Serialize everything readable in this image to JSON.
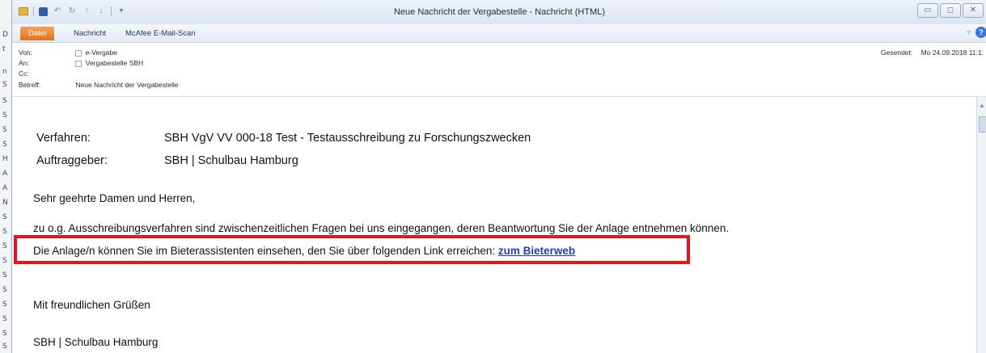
{
  "window": {
    "title": "Neue Nachricht der Vergabestelle  -  Nachricht (HTML)",
    "controls": {
      "minimize": "▭",
      "maximize": "◻",
      "close": "✕"
    }
  },
  "left_strip": {
    "letters": [
      "D",
      "t",
      "n",
      "S",
      "S",
      "S",
      "S",
      "S",
      "H",
      "A",
      "A",
      "N",
      "S",
      "S",
      "S",
      "S",
      "S",
      "S",
      "S",
      "S",
      "S",
      "S"
    ]
  },
  "ribbon": {
    "tabs": [
      "Datei",
      "Nachricht",
      "McAfee E-Mail-Scan"
    ]
  },
  "header": {
    "from_label": "Von:",
    "from_value": "e-Vergabe",
    "to_label": "An:",
    "to_value": "Vergabestelle SBH",
    "cc_label": "Cc:",
    "cc_value": "",
    "subject_label": "Betreff:",
    "subject_value": "Neue Nachricht der Vergabestelle",
    "sent_label": "Gesendet:",
    "sent_value": "Mo 24.09.2018 11:1:"
  },
  "body": {
    "verfahren_label": "Verfahren:",
    "verfahren_value": "SBH VgV VV 000-18 Test - Testausschreibung zu Forschungszwecken",
    "auftraggeber_label": "Auftraggeber:",
    "auftraggeber_value": "SBH | Schulbau Hamburg",
    "greeting": "Sehr geehrte Damen und Herren,",
    "paragraph1": "zu o.g. Ausschreibungsverfahren sind zwischenzeitlichen Fragen bei uns eingegangen, deren Beantwortung Sie der Anlage entnehmen können.",
    "paragraph2": "Die Anlage/n können Sie im Bieterassistenten einsehen, den Sie über folgenden Link erreichen: ",
    "link_text": "zum Bieterweb",
    "closing": "Mit freundlichen Grüßen",
    "signature": "SBH | Schulbau Hamburg"
  },
  "colors": {
    "highlight": "#e8141c",
    "link": "#1f3fbf",
    "file_tab": "#e07420"
  }
}
